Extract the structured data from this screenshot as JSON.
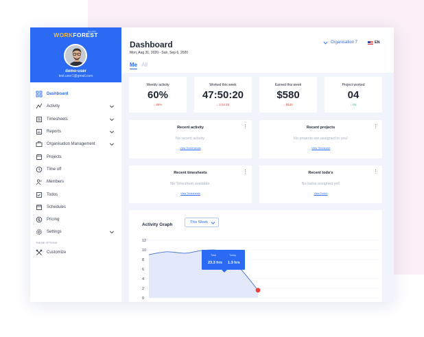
{
  "brand": {
    "part1": "WORK",
    "part2": "FOREST",
    "tagline": "by rich"
  },
  "user": {
    "name": "demo-user",
    "email": "test.user1@gmail.com"
  },
  "sidebar": {
    "items": [
      {
        "label": "Dashboard",
        "icon": "dashboard-icon",
        "active": true,
        "expandable": false
      },
      {
        "label": "Activity",
        "icon": "activity-icon",
        "active": false,
        "expandable": true
      },
      {
        "label": "Timesheets",
        "icon": "timesheet-icon",
        "active": false,
        "expandable": true
      },
      {
        "label": "Reports",
        "icon": "reports-icon",
        "active": false,
        "expandable": true
      },
      {
        "label": "Organisation Management",
        "icon": "briefcase-icon",
        "active": false,
        "expandable": true
      },
      {
        "label": "Projects",
        "icon": "projects-icon",
        "active": false,
        "expandable": false
      },
      {
        "label": "Time off",
        "icon": "clock-icon",
        "active": false,
        "expandable": false
      },
      {
        "label": "Members",
        "icon": "members-icon",
        "active": false,
        "expandable": false
      },
      {
        "label": "Todos",
        "icon": "todos-icon",
        "active": false,
        "expandable": false
      },
      {
        "label": "Schedules",
        "icon": "calendar-icon",
        "active": false,
        "expandable": false
      },
      {
        "label": "Pricing",
        "icon": "pricing-icon",
        "active": false,
        "expandable": false
      },
      {
        "label": "Settings",
        "icon": "gear-icon",
        "active": false,
        "expandable": true
      }
    ],
    "theme_label": "THEME OPTIONS",
    "customize_label": "Customize"
  },
  "header": {
    "title": "Dashboard",
    "date_range": "Mon, Aug 31, 2020 - Sun, Sep 6, 2020",
    "organisation": "Organisation 7",
    "language": "EN",
    "tabs": [
      "Me",
      "All"
    ]
  },
  "stats": [
    {
      "label": "Weekly activity",
      "value": "60%",
      "delta": "↓ 85%",
      "trend": "down"
    },
    {
      "label": "Worked this week",
      "value": "47:50:20",
      "delta": "↓ 2:34:15",
      "trend": "down"
    },
    {
      "label": "Earned this week",
      "value": "$580",
      "delta": "↓ $120",
      "trend": "down"
    },
    {
      "label": "Project worked",
      "value": "04",
      "delta": "↑ 01",
      "trend": "up"
    }
  ],
  "widgets": [
    {
      "title": "Recent activity",
      "empty": "No recent activity.",
      "link": "View Screenshots"
    },
    {
      "title": "Recent projects",
      "empty": "No projects are assigned to you!",
      "link": "View Timesheet"
    },
    {
      "title": "Recent timesheets",
      "empty": "No Timesheet available.",
      "link": "View Timesheets"
    },
    {
      "title": "Recent todo’s",
      "empty": "No todos assigned yet!",
      "link": "View Todo's"
    }
  ],
  "graph": {
    "title": "Activity Graph",
    "range": "This Week",
    "tooltip": {
      "total_label": "Total",
      "today_label": "Today",
      "total_value": "23.3 hrs",
      "today_value": "1.3 hrs"
    }
  },
  "chart_data": {
    "type": "area",
    "yticks": [
      12,
      10,
      8,
      6,
      4,
      2,
      0
    ],
    "ylim": [
      0,
      12
    ],
    "series": [
      {
        "values": [
          9.0,
          9.6,
          9.3,
          9.9,
          9.6,
          6.2,
          1.6
        ]
      }
    ],
    "highlight_index": 6,
    "colors": {
      "line": "#3b6fd8",
      "fill": "#e4e8fb",
      "point": "#e8413d"
    }
  },
  "colors": {
    "accent": "#2b6bf3",
    "negative": "#e0433a",
    "positive": "#2bb06b"
  }
}
